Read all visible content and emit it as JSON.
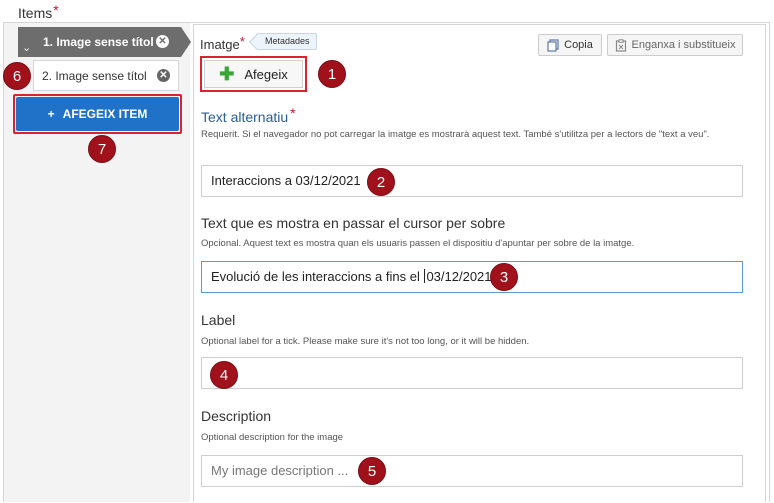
{
  "items_section": {
    "title": "Items",
    "required_mark": "*",
    "items": [
      {
        "label": "1. Image sense títol",
        "remove_icon": "close-circle-icon"
      },
      {
        "label": "2. Image sense títol",
        "remove_icon": "close-circle-icon"
      }
    ],
    "add_item_label": "AFEGEIX ITEM"
  },
  "image_field": {
    "label": "Imatge",
    "required_mark": "*",
    "metadata_tag": "Metadades",
    "add_button_label": "Afegeix",
    "copy_button_label": "Copia",
    "paste_button_label": "Enganxa i substitueix"
  },
  "alt_text": {
    "label": "Text alternatiu",
    "required_mark": "*",
    "description": "Requerit. Si el navegador no pot carregar la imatge es mostrarà aquest text. També s'utilitza per a lectors de \"text a veu\".",
    "value": "Interaccions a 03/12/2021"
  },
  "hover_text": {
    "label": "Text que es mostra en passar el cursor per sobre",
    "description": "Opcional. Aquest text es mostra quan els usuaris passen el dispositiu d'apuntar per sobre de la imatge.",
    "value_before_caret": "Evolució de les interaccions a fins el ",
    "value_after_caret": "03/12/2021"
  },
  "label_field": {
    "label": "Label",
    "description": "Optional label for a tick. Please make sure it's not too long, or it will be hidden.",
    "value": ""
  },
  "description_field": {
    "label": "Description",
    "description": "Optional description for the image",
    "placeholder": "My image description ..."
  },
  "annotations": [
    "1",
    "2",
    "3",
    "4",
    "5",
    "6",
    "7"
  ],
  "colors": {
    "accent_blue": "#1f72c8",
    "required_red": "#c8102e",
    "annotation_badge": "#a0111b",
    "highlight_outline": "#d9232d"
  }
}
